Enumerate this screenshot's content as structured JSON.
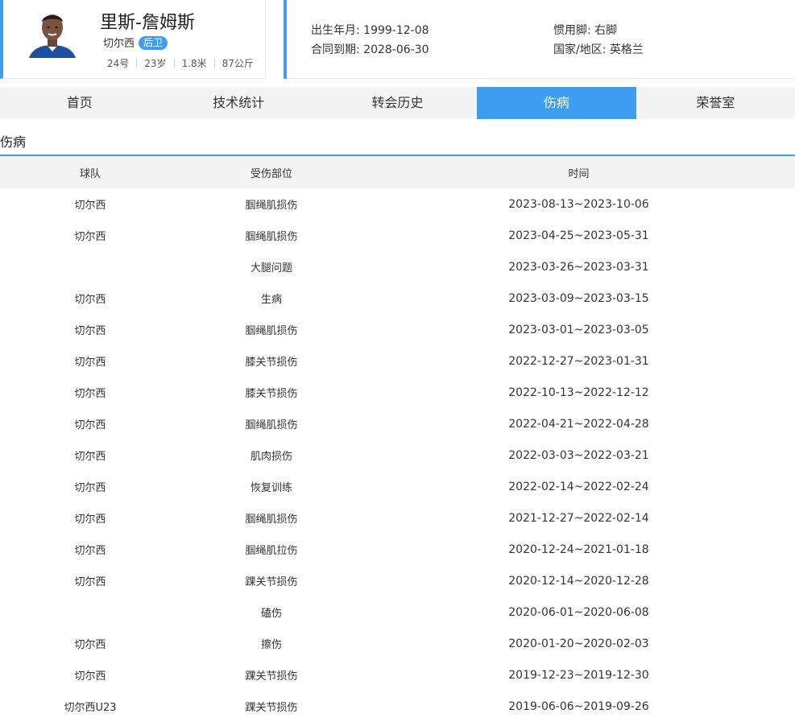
{
  "player": {
    "name": "里斯-詹姆斯",
    "team": "切尔西",
    "position": "后卫",
    "number": "24号",
    "age": "23岁",
    "height": "1.8米",
    "weight": "87公斤"
  },
  "info": {
    "birth": "出生年月: 1999-12-08",
    "contract": "合同到期: 2028-06-30",
    "foot": "惯用脚: 右脚",
    "country": "国家/地区: 英格兰"
  },
  "tabs": [
    "首页",
    "技术统计",
    "转会历史",
    "伤病",
    "荣誉室"
  ],
  "active_tab": "伤病",
  "section_title": "伤病",
  "table": {
    "headers": [
      "球队",
      "受伤部位",
      "时间"
    ],
    "rows": [
      [
        "切尔西",
        "腘绳肌损伤",
        "2023-08-13~2023-10-06"
      ],
      [
        "切尔西",
        "腘绳肌损伤",
        "2023-04-25~2023-05-31"
      ],
      [
        "",
        "大腿问题",
        "2023-03-26~2023-03-31"
      ],
      [
        "切尔西",
        "生病",
        "2023-03-09~2023-03-15"
      ],
      [
        "切尔西",
        "腘绳肌损伤",
        "2023-03-01~2023-03-05"
      ],
      [
        "切尔西",
        "膝关节损伤",
        "2022-12-27~2023-01-31"
      ],
      [
        "切尔西",
        "膝关节损伤",
        "2022-10-13~2022-12-12"
      ],
      [
        "切尔西",
        "腘绳肌损伤",
        "2022-04-21~2022-04-28"
      ],
      [
        "切尔西",
        "肌肉损伤",
        "2022-03-03~2022-03-21"
      ],
      [
        "切尔西",
        "恢复训练",
        "2022-02-14~2022-02-24"
      ],
      [
        "切尔西",
        "腘绳肌损伤",
        "2021-12-27~2022-02-14"
      ],
      [
        "切尔西",
        "腘绳肌拉伤",
        "2020-12-24~2021-01-18"
      ],
      [
        "切尔西",
        "踝关节损伤",
        "2020-12-14~2020-12-28"
      ],
      [
        "",
        "磕伤",
        "2020-06-01~2020-06-08"
      ],
      [
        "切尔西",
        "擦伤",
        "2020-01-20~2020-02-03"
      ],
      [
        "切尔西",
        "踝关节损伤",
        "2019-12-23~2019-12-30"
      ],
      [
        "切尔西U23",
        "踝关节损伤",
        "2019-06-06~2019-09-26"
      ]
    ]
  },
  "colors": {
    "accent": "#3d9ef0",
    "tab_bg": "#f4f4f4"
  }
}
